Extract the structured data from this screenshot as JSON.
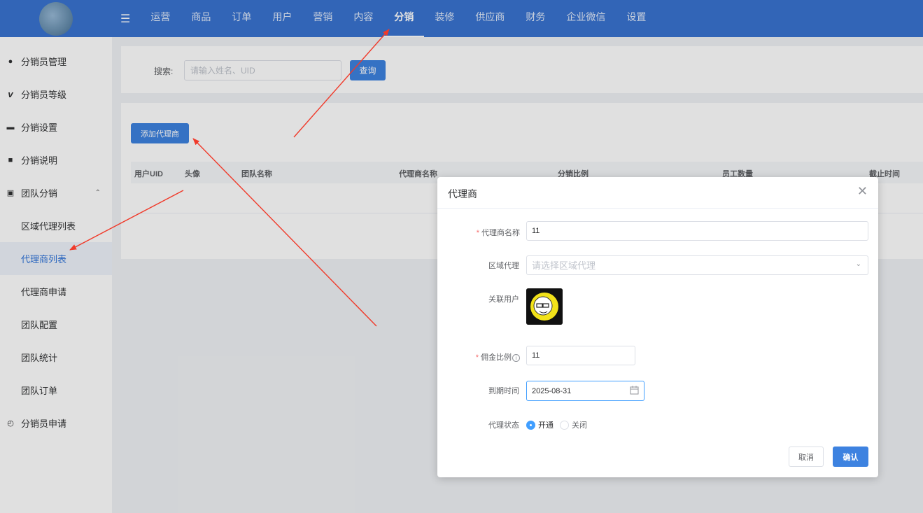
{
  "nav": {
    "items": [
      "运营",
      "商品",
      "订单",
      "用户",
      "营销",
      "内容",
      "分销",
      "装修",
      "供应商",
      "财务",
      "企业微信",
      "设置"
    ],
    "active_index": 6
  },
  "sidebar": {
    "items": [
      {
        "label": "分销员管理",
        "icon": "person-icon"
      },
      {
        "label": "分销员等级",
        "icon": "v-icon"
      },
      {
        "label": "分销设置",
        "icon": "toggle-icon"
      },
      {
        "label": "分销说明",
        "icon": "book-icon"
      },
      {
        "label": "团队分销",
        "icon": "briefcase-icon",
        "expanded": true
      },
      {
        "label": "区域代理列表",
        "sub": true
      },
      {
        "label": "代理商列表",
        "sub": true,
        "active": true
      },
      {
        "label": "代理商申请",
        "sub": true
      },
      {
        "label": "团队配置",
        "sub": true
      },
      {
        "label": "团队统计",
        "sub": true
      },
      {
        "label": "团队订单",
        "sub": true
      },
      {
        "label": "分销员申请",
        "icon": "clock-icon"
      }
    ]
  },
  "search": {
    "label": "搜索:",
    "placeholder": "请输入姓名、UID",
    "button": "查询"
  },
  "table": {
    "add_button": "添加代理商",
    "columns": [
      "用户UID",
      "头像",
      "团队名称",
      "代理商名称",
      "分销比例",
      "员工数量",
      "截止时间"
    ]
  },
  "dialog": {
    "title": "代理商",
    "fields": {
      "agent_name": {
        "label": "代理商名称",
        "value": "11",
        "required": true
      },
      "region_agent": {
        "label": "区域代理",
        "placeholder": "请选择区域代理"
      },
      "linked_user": {
        "label": "关联用户"
      },
      "commission": {
        "label": "佣金比例",
        "value": "11",
        "required": true
      },
      "expire": {
        "label": "到期时间",
        "value": "2025-08-31"
      },
      "status": {
        "label": "代理状态",
        "options": [
          "开通",
          "关闭"
        ],
        "selected": 0
      }
    },
    "cancel": "取消",
    "confirm": "确认"
  },
  "colors": {
    "nav_bg": "#3a74d1",
    "primary": "#3d82e0",
    "annotation_arrow": "#f03a2a"
  }
}
